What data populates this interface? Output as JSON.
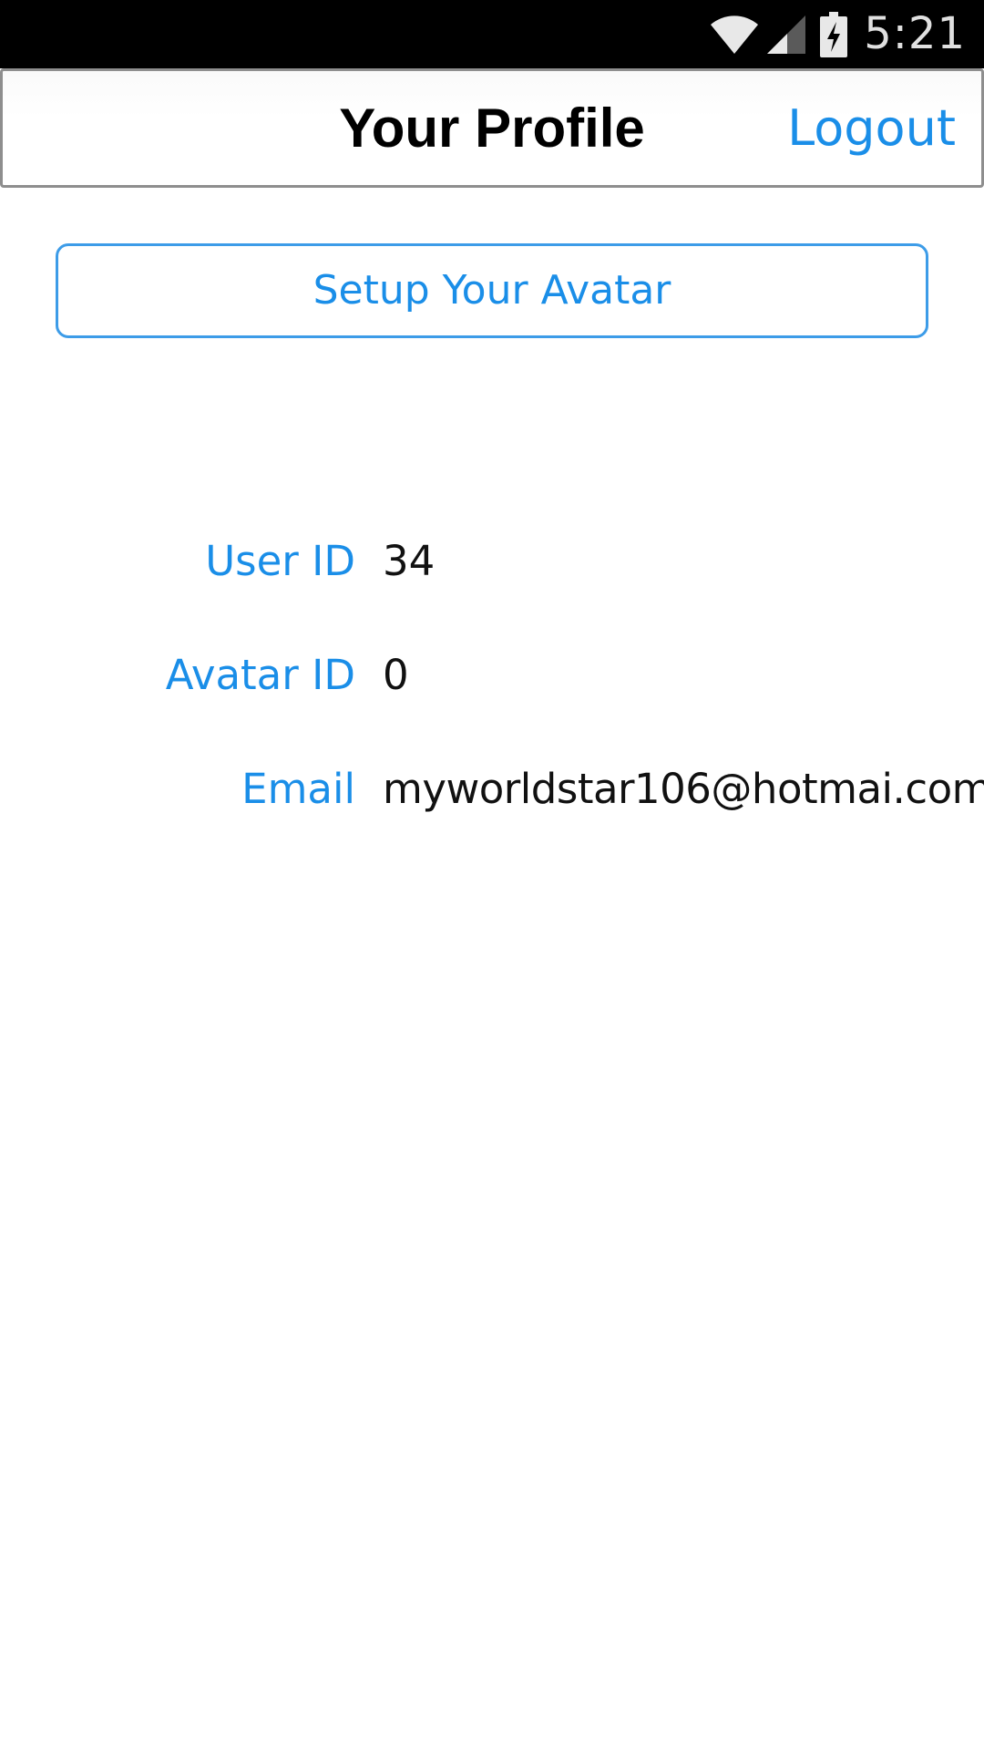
{
  "status_bar": {
    "time": "5:21",
    "icons": [
      "wifi-icon",
      "cell-signal-icon",
      "battery-charging-icon"
    ]
  },
  "nav": {
    "title": "Your Profile",
    "logout_label": "Logout"
  },
  "avatar_button": {
    "label": "Setup Your Avatar"
  },
  "profile": {
    "rows": [
      {
        "label": "User ID",
        "value": "34"
      },
      {
        "label": "Avatar ID",
        "value": "0"
      },
      {
        "label": "Email",
        "value": "myworldstar106@hotmai.com"
      }
    ]
  },
  "colors": {
    "accent": "#1a8ee8",
    "status_bar": "#000000",
    "text": "#111111"
  }
}
